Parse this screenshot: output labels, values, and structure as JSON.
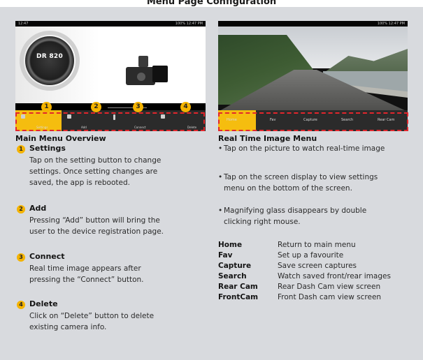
{
  "title": "Menu Page Configuration",
  "left_screenshot": {
    "status_left": "12:47",
    "status_right": "100% 12:47 PM",
    "product_text": "DR 820",
    "nav_labels": [
      "Settings",
      "Add",
      "Connect",
      "Delete"
    ],
    "badges": [
      "1",
      "2",
      "3",
      "4"
    ]
  },
  "right_screenshot": {
    "status_left": "",
    "status_right": "100% 12:47 PM",
    "nav_labels": [
      "Home",
      "Fav",
      "Capture",
      "Search",
      "Rear Cam"
    ]
  },
  "main_menu": {
    "heading": "Main Menu Overview",
    "items": [
      {
        "num": "1",
        "title": "Settings",
        "lines": [
          "Tap on the setting button to change",
          "settings. Once setting changes are",
          "saved, the app is rebooted."
        ]
      },
      {
        "num": "2",
        "title": "Add",
        "lines": [
          "Pressing “Add” button will bring the",
          "user to the device registration page."
        ]
      },
      {
        "num": "3",
        "title": "Connect",
        "lines": [
          "Real time image appears after",
          "pressing the “Connect”  button."
        ]
      },
      {
        "num": "4",
        "title": "Delete",
        "lines": [
          "Click on “Delete” button to delete",
          "existing camera info."
        ]
      }
    ]
  },
  "realtime_menu": {
    "heading": "Real Time Image Menu",
    "bullets": [
      [
        "Tap on the picture to watch real-time image"
      ],
      [
        "Tap on the screen display to view settings",
        "menu on the bottom of the screen."
      ],
      [
        "Magnifying glass disappears by double",
        "clicking right mouse."
      ]
    ],
    "table": [
      {
        "key": "Home",
        "value": "Return to main menu"
      },
      {
        "key": "Fav",
        "value": "Set up a favourite"
      },
      {
        "key": "Capture",
        "value": "Save screen captures"
      },
      {
        "key": "Search",
        "value": "Watch saved front/rear images"
      },
      {
        "key": "Rear Cam",
        "value": "Rear Dash Cam view screen"
      },
      {
        "key": "FrontCam",
        "value": "Front Dash cam view screen"
      }
    ]
  },
  "colors": {
    "accent": "#f4b300",
    "dash": "#e3262c",
    "panel": "#d8dade"
  }
}
